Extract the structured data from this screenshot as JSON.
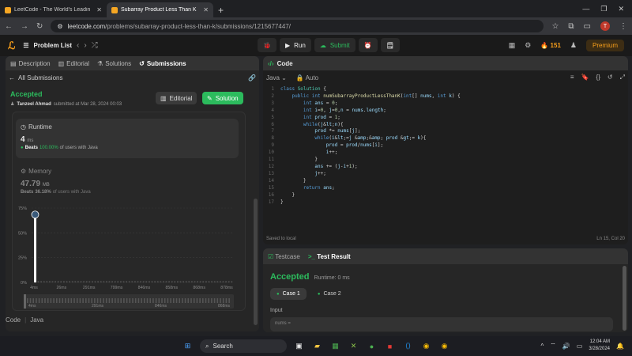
{
  "browser": {
    "tabs": [
      {
        "label": "LeetCode - The World's Leadin",
        "active": false
      },
      {
        "label": "Subarray Product Less Than K",
        "active": true
      }
    ],
    "url_host": "leetcode.com",
    "url_path": "/problems/subarray-product-less-than-k/submissions/1215677447/"
  },
  "lc_header": {
    "problem_list": "Problem List",
    "run": "Run",
    "submit": "Submit",
    "streak": "151",
    "premium": "Premium"
  },
  "left": {
    "tabs": [
      "Description",
      "Editorial",
      "Solutions",
      "Submissions"
    ],
    "all_submissions": "All Submissions",
    "status": "Accepted",
    "user": "Tanzeel Ahmad",
    "submitted_text": "submitted at Mar 28, 2024 00:03",
    "editorial_btn": "Editorial",
    "solution_btn": "Solution",
    "runtime": {
      "label": "Runtime",
      "value": "4",
      "unit": "ms",
      "beats_prefix": "Beats",
      "beats_pct": "100.00%",
      "beats_suffix": "of users with Java"
    },
    "memory": {
      "label": "Memory",
      "value": "47.79",
      "unit": "MB",
      "beats_prefix": "Beats",
      "beats_pct": "36.18%",
      "beats_suffix": "of users with Java"
    },
    "footer_code": "Code",
    "footer_lang": "Java"
  },
  "chart_data": {
    "type": "bar",
    "y_ticks": [
      "75%",
      "50%",
      "25%",
      "0%"
    ],
    "x_ticks": [
      "4ms",
      "26ms",
      "291ms",
      "799ms",
      "846ms",
      "858ms",
      "868ms",
      "878ms"
    ],
    "range_ticks": [
      "4ms",
      "291ms",
      "846ms",
      "868ms"
    ],
    "highlight": {
      "x": "4ms",
      "value": 70
    },
    "ylim": [
      0,
      75
    ]
  },
  "editor": {
    "title": "Code",
    "language": "Java",
    "mode": "Auto",
    "saved": "Saved to local",
    "cursor": "Ln 15, Col 20",
    "lines": [
      "class Solution {",
      "    public int numSubarrayProductLessThanK(int[] nums, int k) {",
      "        int ans = 0;",
      "        int i=0, j=0,n = nums.length;",
      "        int prod = 1;",
      "        while(j<n){",
      "            prod *= nums[j];",
      "            while(i<=j && prod >= k){",
      "                prod = prod/nums[i];",
      "                i++;",
      "            }",
      "            ans += (j-i+1);",
      "            j++;",
      "        }",
      "        return ans;",
      "    }",
      "}"
    ]
  },
  "test": {
    "tab_testcase": "Testcase",
    "tab_result": "Test Result",
    "status": "Accepted",
    "runtime": "Runtime: 0 ms",
    "case1": "Case 1",
    "case2": "Case 2",
    "input_label": "Input",
    "input_value": "nums ="
  },
  "taskbar": {
    "search": "Search",
    "time": "12:04 AM",
    "date": "3/28/2024"
  }
}
